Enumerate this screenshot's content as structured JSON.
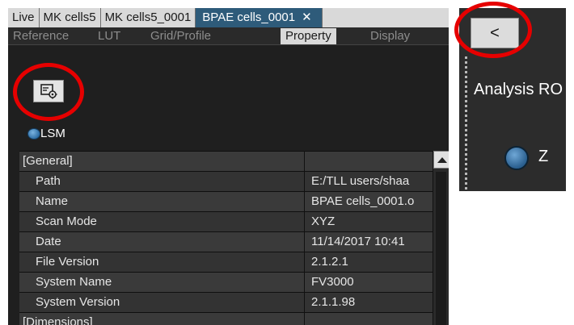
{
  "tabs": [
    {
      "label": "Live",
      "active": false
    },
    {
      "label": "MK cells5",
      "active": false
    },
    {
      "label": "MK cells5_0001",
      "active": false
    },
    {
      "label": "BPAE cells_0001",
      "active": true,
      "close_glyph": "✕"
    }
  ],
  "subtabs": [
    "Reference",
    "LUT",
    "Grid/Profile",
    "Property",
    "Display"
  ],
  "active_subtab": "Property",
  "toolbar": {
    "icon": "property-settings-icon"
  },
  "radio": {
    "label": "LSM",
    "selected": true
  },
  "properties": [
    {
      "name": "[General]",
      "value": "",
      "section": true
    },
    {
      "name": "Path",
      "value": "E:/TLL users/shaa"
    },
    {
      "name": "Name",
      "value": "BPAE cells_0001.o"
    },
    {
      "name": "Scan Mode",
      "value": "XYZ"
    },
    {
      "name": "Date",
      "value": "11/14/2017 10:41"
    },
    {
      "name": "File Version",
      "value": "2.1.2.1"
    },
    {
      "name": "System Name",
      "value": "FV3000"
    },
    {
      "name": "System Version",
      "value": "2.1.1.98"
    },
    {
      "name": "[Dimensions]",
      "value": "",
      "section": true
    }
  ],
  "side_panel": {
    "back_label": "<",
    "title": "Analysis RO",
    "z_label": "Z"
  },
  "colors": {
    "highlight_ring": "#e60000",
    "active_tab": "#2e5b7a",
    "panel_bg": "#1f1f1f"
  }
}
